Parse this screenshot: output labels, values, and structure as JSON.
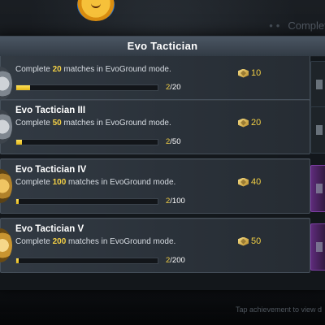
{
  "background": {
    "right_text": "Complete",
    "bottom_hint": "Tap achievement to view d"
  },
  "dialog": {
    "title": "Evo Tactician"
  },
  "achievements": [
    {
      "title": "",
      "desc_prefix": "Complete ",
      "desc_count": "20",
      "desc_suffix": " matches in EvoGround mode.",
      "progress_current": "2",
      "progress_total": "/20",
      "progress_fraction": 0.1,
      "reward": "10",
      "reward_icon": "achievement-points-icon",
      "badge": "silver"
    },
    {
      "title": "Evo Tactician III",
      "desc_prefix": "Complete ",
      "desc_count": "50",
      "desc_suffix": " matches in EvoGround mode.",
      "progress_current": "2",
      "progress_total": "/50",
      "progress_fraction": 0.04,
      "reward": "20",
      "reward_icon": "achievement-points-icon",
      "badge": "silver"
    },
    {
      "title": "Evo Tactician IV",
      "desc_prefix": "Complete ",
      "desc_count": "100",
      "desc_suffix": " matches in EvoGround mode.",
      "progress_current": "2",
      "progress_total": "/100",
      "progress_fraction": 0.02,
      "reward": "40",
      "reward_icon": "achievement-points-icon",
      "badge": "gold"
    },
    {
      "title": "Evo Tactician V",
      "desc_prefix": "Complete ",
      "desc_count": "200",
      "desc_suffix": " matches in EvoGround mode.",
      "progress_current": "2",
      "progress_total": "/200",
      "progress_fraction": 0.01,
      "reward": "50",
      "reward_icon": "achievement-points-icon",
      "badge": "gold2"
    }
  ],
  "colors": {
    "accent_gold": "#f2cf45",
    "header_bg": "#4b5663"
  }
}
